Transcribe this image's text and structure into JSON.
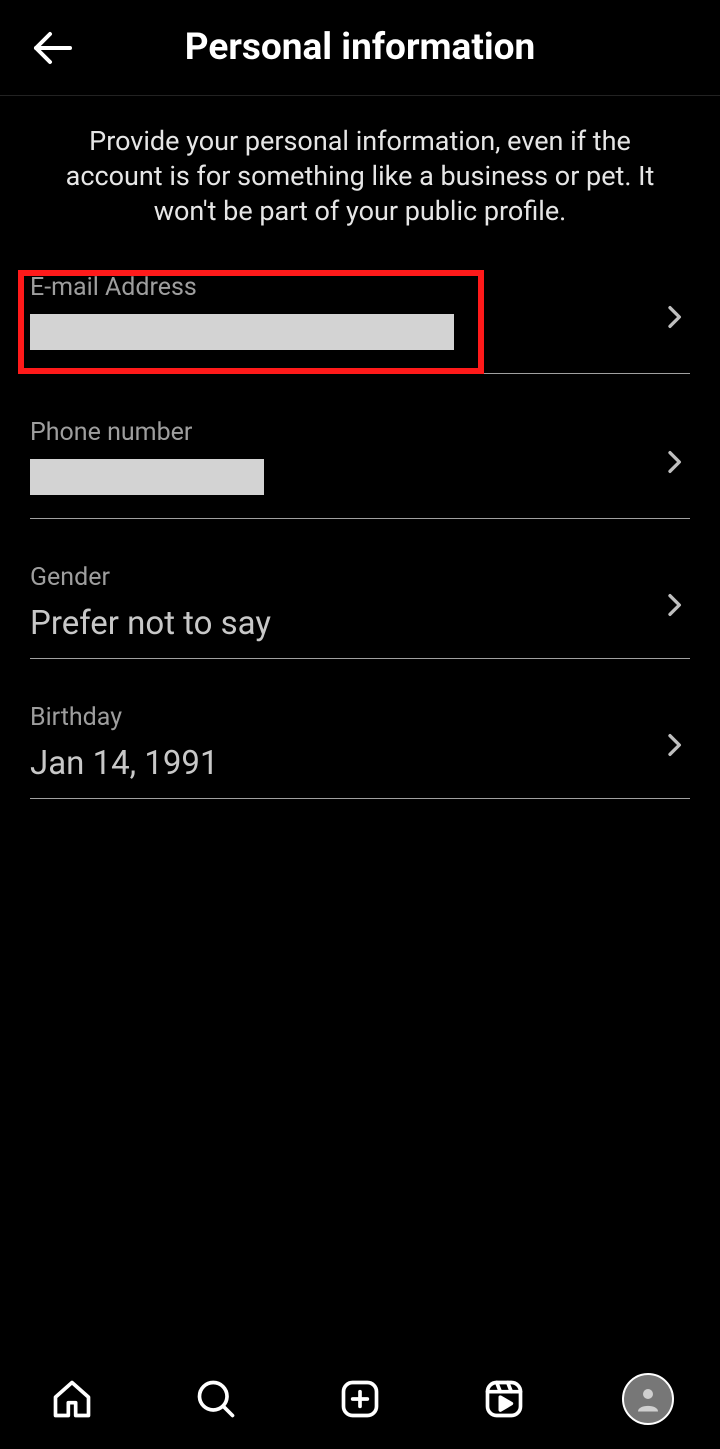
{
  "header": {
    "title": "Personal information"
  },
  "intro": "Provide your personal information, even if the account is for something like a business or pet. It won't be part of your public profile.",
  "fields": {
    "email": {
      "label": "E-mail Address",
      "value": "",
      "redacted_width": 424
    },
    "phone": {
      "label": "Phone number",
      "value": "",
      "redacted_width": 234
    },
    "gender": {
      "label": "Gender",
      "value": "Prefer not to say"
    },
    "birthday": {
      "label": "Birthday",
      "value": "Jan 14, 1991"
    }
  },
  "highlight_color": "#ff1a1a"
}
